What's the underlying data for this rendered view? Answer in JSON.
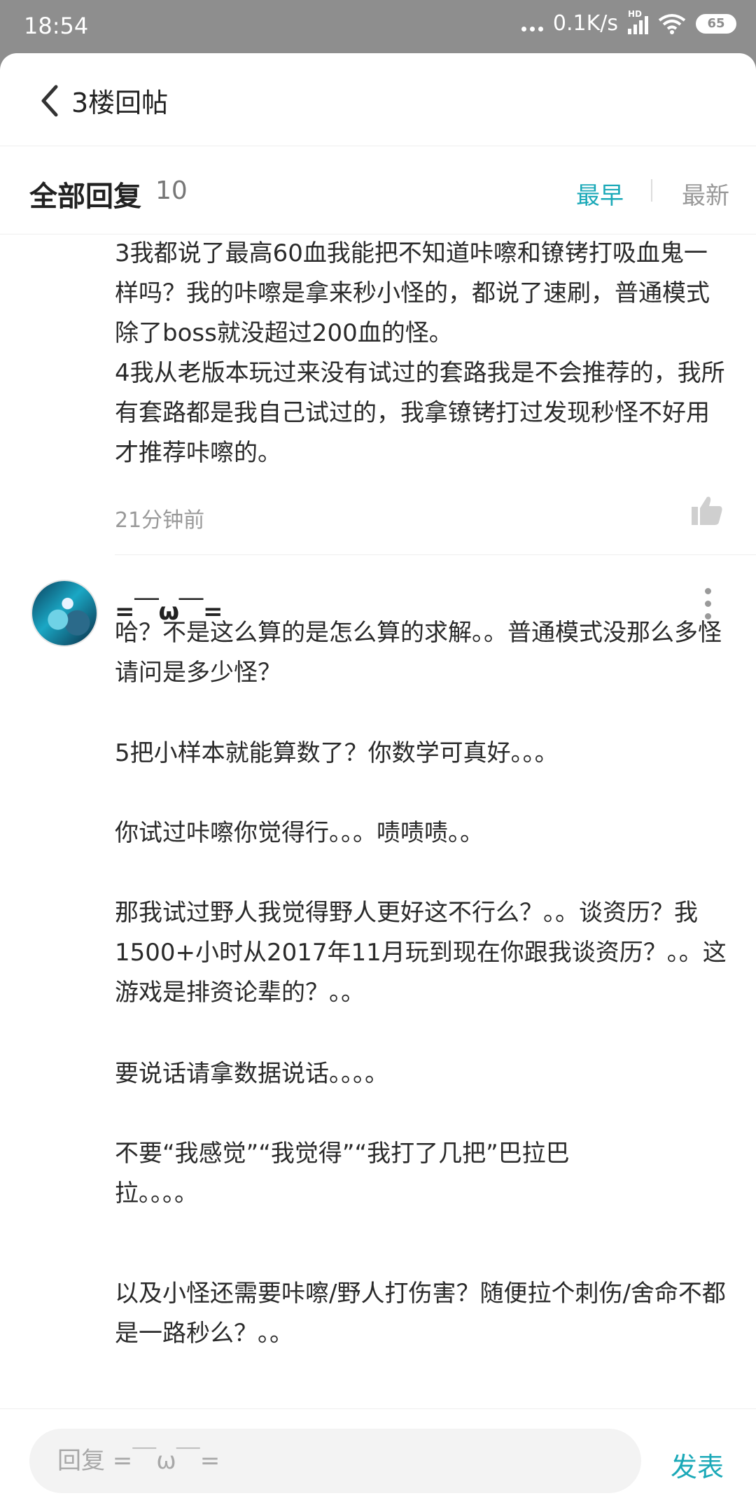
{
  "status_bar": {
    "time": "18:54",
    "net_speed": "0.1K/s",
    "network_badge": "HD",
    "battery": "65"
  },
  "header": {
    "title": "3楼回帖",
    "back_icon": "chevron-left-icon"
  },
  "replies_header": {
    "label": "全部回复",
    "count": "10",
    "sort_earliest": "最早",
    "sort_newest": "最新",
    "active_sort_color": "#1ba9b8"
  },
  "first_reply": {
    "text": "3我都说了最高60血我能把不知道咔嚓和镣铐打吸血鬼一样吗？我的咔嚓是拿来秒小怪的，都说了速刷，普通模式除了boss就没超过200血的怪。\n4我从老版本玩过来没有试过的套路我是不会推荐的，我所有套路都是我自己试过的，我拿镣铐打过发现秒怪不好用才推荐咔嚓的。",
    "time_ago": "21分钟前"
  },
  "second_reply": {
    "username": "=￣ω￣=",
    "paragraphs": [
      "哈？不是这么算的是怎么算的求解。。普通模式没那么多怪请问是多少怪？",
      "5把小样本就能算数了？你数学可真好。。。",
      "你试过咔嚓你觉得行。。。啧啧啧。。",
      "那我试过野人我觉得野人更好这不行么？。。谈资历？我1500+小时从2017年11月玩到现在你跟我谈资历？。。这游戏是排资论辈的？。。",
      "要说话请拿数据说话。。。。",
      "不要“我感觉”“我觉得”“我打了几把”巴拉巴拉。。。。",
      "以及小怪还需要咔嚓/野人打伤害？随便拉个刺伤/舍命不都是一路秒么？。。"
    ]
  },
  "composer": {
    "placeholder": "回复 =￣ω￣=",
    "send_label": "发表"
  }
}
